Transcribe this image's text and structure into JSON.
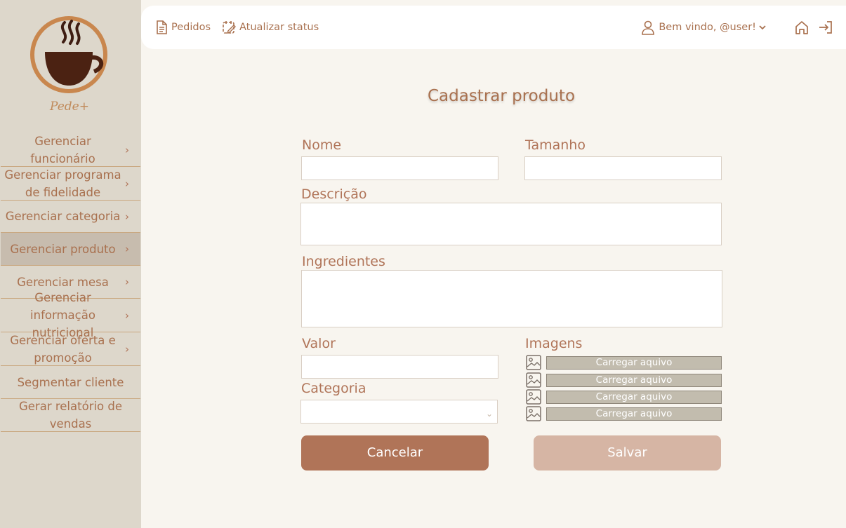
{
  "brand": {
    "logo_text": "Pede+"
  },
  "sidebar": {
    "items": [
      {
        "label": "Gerenciar funcionário",
        "chevron": true
      },
      {
        "label": "Gerenciar programa de fidelidade",
        "chevron": true
      },
      {
        "label": "Gerenciar categoria",
        "chevron": true
      },
      {
        "label": "Gerenciar produto",
        "chevron": true,
        "active": true
      },
      {
        "label": "Gerenciar mesa",
        "chevron": true
      },
      {
        "label": "Gerenciar informação nutricional",
        "chevron": true
      },
      {
        "label": "Gerenciar oferta e promoção",
        "chevron": true
      },
      {
        "label": "Segmentar cliente",
        "chevron": false
      },
      {
        "label": "Gerar relatório de vendas",
        "chevron": false
      }
    ]
  },
  "topbar": {
    "orders_label": "Pedidos",
    "update_status_label": "Atualizar status",
    "welcome_label": "Bem vindo, @user!",
    "icons": [
      "document-icon",
      "calendar-edit-icon",
      "user-icon",
      "chevron-down-icon",
      "home-icon",
      "logout-icon"
    ]
  },
  "form": {
    "title": "Cadastrar produto",
    "name_label": "Nome",
    "size_label": "Tamanho",
    "description_label": "Descrição",
    "ingredients_label": "Ingredientes",
    "value_label": "Valor",
    "category_label": "Categoria",
    "images_label": "Imagens",
    "name_value": "",
    "size_value": "",
    "description_value": "",
    "ingredients_value": "",
    "value_value": "",
    "category_value": "",
    "upload_buttons": [
      "Carregar aquivo",
      "Carregar aquivo",
      "Carregar aquivo",
      "Carregar aquivo"
    ],
    "cancel_label": "Cancelar",
    "save_label": "Salvar"
  },
  "colors": {
    "sidebar_bg": "#ddd7cb",
    "active_item_bg": "#c7bcae",
    "accent": "#b07458",
    "save_button": "#d6b5a4",
    "page_bg": "#f8f5ef"
  }
}
